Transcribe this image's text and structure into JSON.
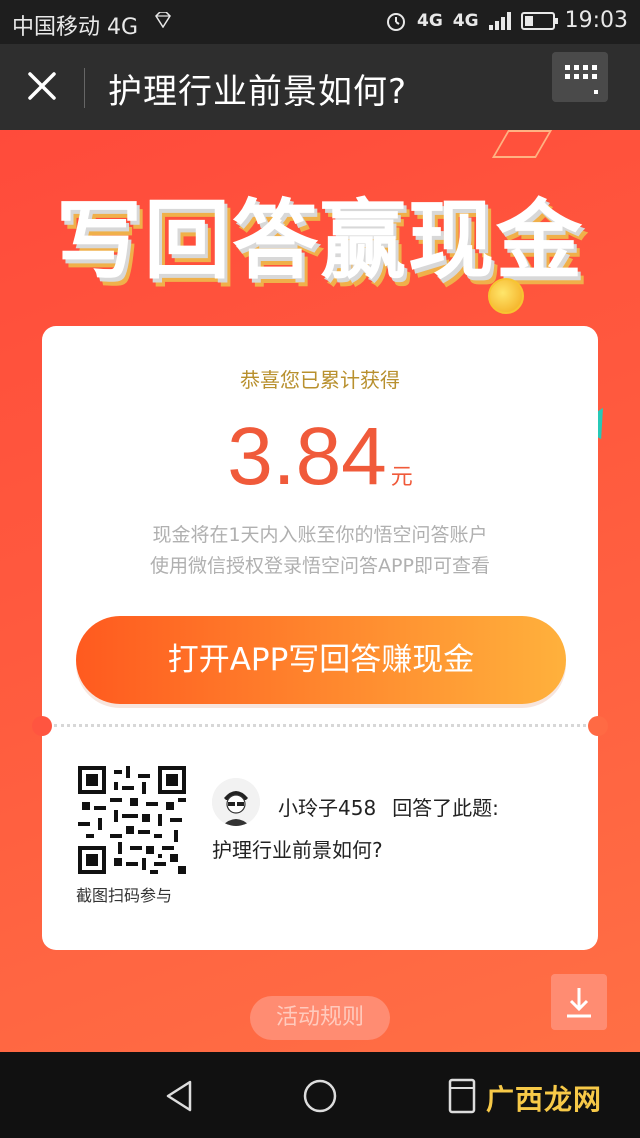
{
  "status_bar": {
    "carrier": "中国移动 4G",
    "net1": "4G",
    "net2": "4G",
    "time": "19:03"
  },
  "nav": {
    "title": "护理行业前景如何?",
    "close_icon": "close-icon",
    "menu_icon": "more-grid-icon"
  },
  "banner": {
    "title": "写回答赢现金"
  },
  "card": {
    "congrats": "恭喜您已累计获得",
    "amount": "3.84",
    "unit": "元",
    "info_line1": "现金将在1天内入账至你的悟空问答账户",
    "info_line2": "使用微信授权登录悟空问答APP即可查看",
    "open_button": "打开APP写回答赚现金",
    "qr_caption": "截图扫码参与",
    "username": "小玲子458",
    "answered": "回答了此题:",
    "question": "护理行业前景如何?"
  },
  "footer": {
    "rules_button": "活动规则"
  },
  "watermark": "广西龙网",
  "colors": {
    "accent_red": "#ff4b3b",
    "amount_red": "#f05a3a",
    "gold_text": "#b8902e"
  }
}
